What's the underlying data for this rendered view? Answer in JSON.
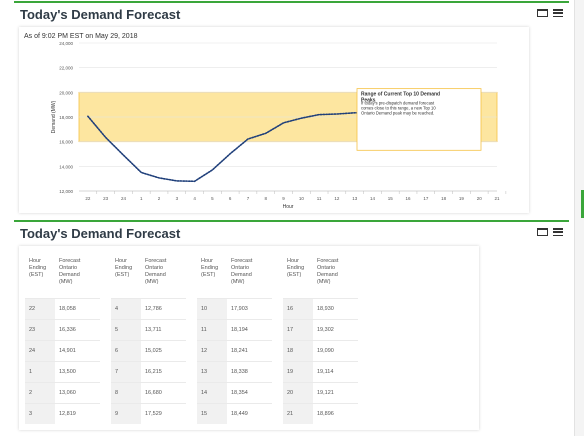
{
  "chart_panel": {
    "title": "Today's Demand Forecast",
    "subtitle": "As of 9:02 PM EST on May 29, 2018"
  },
  "chart_data": {
    "type": "line",
    "xlabel": "Hour",
    "ylabel": "Demand (MW)",
    "ylim": [
      12000,
      24000
    ],
    "y_ticks": [
      "12,000",
      "14,000",
      "16,000",
      "18,000",
      "20,000",
      "22,000",
      "24,000"
    ],
    "x_ticks": [
      "22",
      "23",
      "24",
      "1",
      "2",
      "3",
      "4",
      "5",
      "6",
      "7",
      "8",
      "9",
      "10",
      "11",
      "12",
      "13",
      "14",
      "15",
      "16",
      "17",
      "18",
      "19",
      "20",
      "21"
    ],
    "band": {
      "from": 16000,
      "to": 20000,
      "color": "#fde6a0",
      "border": "#f6c244"
    },
    "line_color": "#1f3f7a",
    "series": [
      {
        "x": [
          "22",
          "23",
          "24",
          "1",
          "2",
          "3",
          "4",
          "5",
          "6",
          "7",
          "8",
          "9",
          "10",
          "11",
          "12",
          "13",
          "14"
        ],
        "values": [
          18058,
          16336,
          14901,
          13500,
          13060,
          12819,
          12786,
          13711,
          15025,
          16215,
          16680,
          17529,
          17903,
          18194,
          18241,
          18338,
          18354
        ]
      }
    ],
    "grid": true,
    "annotation": {
      "title": "Range of Current Top 10 Demand Peaks",
      "body": "If today's pre-dispatch demand forecast comes close to this range, a new Top 10 Ontario Demand peak may be reached."
    }
  },
  "table_panel": {
    "title": "Today's Demand Forecast",
    "headers": {
      "hour": [
        "Hour",
        "Ending",
        "(EST)"
      ],
      "demand": [
        "Forecast",
        "Ontario",
        "Demand",
        "(MW)"
      ]
    },
    "columns": [
      [
        [
          "22",
          "18,058"
        ],
        [
          "23",
          "16,336"
        ],
        [
          "24",
          "14,901"
        ],
        [
          "1",
          "13,500"
        ],
        [
          "2",
          "13,060"
        ],
        [
          "3",
          "12,819"
        ]
      ],
      [
        [
          "4",
          "12,786"
        ],
        [
          "5",
          "13,711"
        ],
        [
          "6",
          "15,025"
        ],
        [
          "7",
          "16,215"
        ],
        [
          "8",
          "16,680"
        ],
        [
          "9",
          "17,529"
        ]
      ],
      [
        [
          "10",
          "17,903"
        ],
        [
          "11",
          "18,194"
        ],
        [
          "12",
          "18,241"
        ],
        [
          "13",
          "18,338"
        ],
        [
          "14",
          "18,354"
        ],
        [
          "15",
          "18,449"
        ]
      ],
      [
        [
          "16",
          "18,930"
        ],
        [
          "17",
          "19,302"
        ],
        [
          "18",
          "19,090"
        ],
        [
          "19",
          "19,114"
        ],
        [
          "20",
          "19,121"
        ],
        [
          "21",
          "18,896"
        ]
      ]
    ]
  },
  "icons": {
    "window": "window-icon",
    "menu": "menu-icon"
  }
}
